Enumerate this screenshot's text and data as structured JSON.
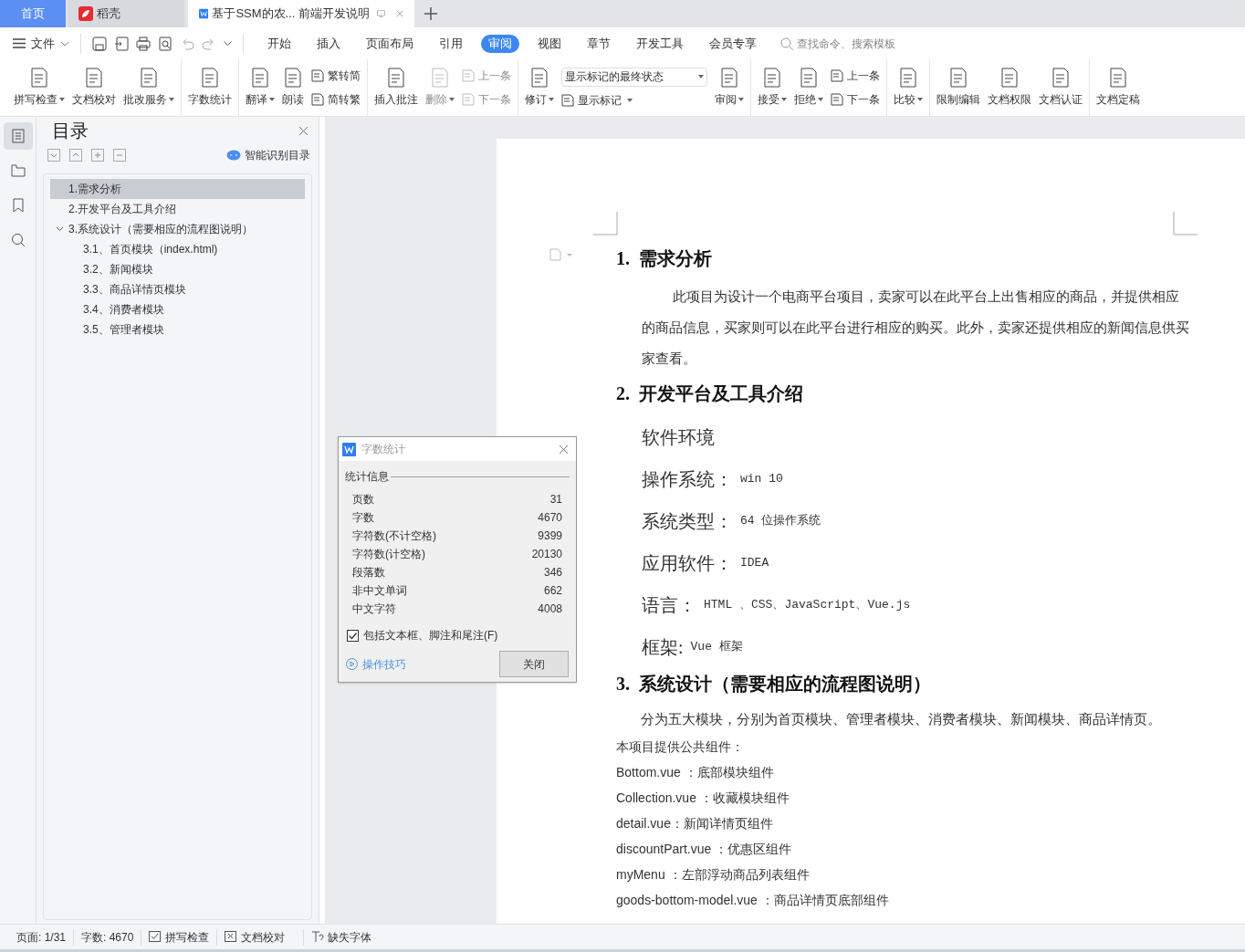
{
  "tabs": [
    {
      "kind": "home",
      "label": "首页",
      "selected": false
    },
    {
      "kind": "app",
      "label": "稻壳",
      "selected": false
    },
    {
      "kind": "document",
      "label": "基于SSM的农... 前端开发说明",
      "selected": true
    }
  ],
  "menu": {
    "file": "文件",
    "ribbon_tabs": [
      {
        "label": "开始",
        "selected": false
      },
      {
        "label": "插入",
        "selected": false
      },
      {
        "label": "页面布局",
        "selected": false
      },
      {
        "label": "引用",
        "selected": false
      },
      {
        "label": "审阅",
        "selected": true
      },
      {
        "label": "视图",
        "selected": false
      },
      {
        "label": "章节",
        "selected": false
      },
      {
        "label": "开发工具",
        "selected": false
      },
      {
        "label": "会员专享",
        "selected": false
      }
    ],
    "search": {
      "placeholder": "查找命令、搜索模板"
    }
  },
  "ribbon": [
    {
      "items": [
        {
          "kind": "large",
          "label": "拼写检查",
          "caret": true,
          "disabled": false
        },
        {
          "kind": "large",
          "label": "文档校对",
          "caret": false,
          "disabled": false
        },
        {
          "kind": "large",
          "label": "批改服务",
          "caret": true,
          "disabled": false
        }
      ]
    },
    {
      "items": [
        {
          "kind": "large",
          "label": "字数统计",
          "caret": false,
          "disabled": false
        }
      ]
    },
    {
      "items": [
        {
          "kind": "large",
          "label": "翻译",
          "caret": true,
          "disabled": false
        },
        {
          "kind": "large",
          "label": "朗读",
          "caret": false,
          "disabled": false
        },
        {
          "kind": "stack",
          "rows": [
            {
              "label": "繁转简",
              "disabled": false
            },
            {
              "label": "简转繁",
              "disabled": false
            }
          ]
        }
      ]
    },
    {
      "items": [
        {
          "kind": "large",
          "label": "插入批注",
          "caret": false,
          "disabled": false
        },
        {
          "kind": "large",
          "label": "删除",
          "caret": true,
          "disabled": true
        },
        {
          "kind": "stack",
          "rows": [
            {
              "label": "上一条",
              "disabled": true
            },
            {
              "label": "下一条",
              "disabled": true
            }
          ]
        }
      ]
    },
    {
      "items": [
        {
          "kind": "large",
          "label": "修订",
          "caret": true,
          "disabled": false
        },
        {
          "kind": "markup",
          "value": "显示标记的最终状态",
          "label": "显示标记"
        },
        {
          "kind": "large",
          "label": "审阅",
          "caret": true,
          "disabled": false
        }
      ]
    },
    {
      "items": [
        {
          "kind": "large",
          "label": "接受",
          "caret": true,
          "disabled": false
        },
        {
          "kind": "large",
          "label": "拒绝",
          "caret": true,
          "disabled": false
        },
        {
          "kind": "stack",
          "rows": [
            {
              "label": "上一条",
              "disabled": false
            },
            {
              "label": "下一条",
              "disabled": false
            }
          ]
        }
      ]
    },
    {
      "items": [
        {
          "kind": "large",
          "label": "比较",
          "caret": true,
          "disabled": false
        }
      ]
    },
    {
      "items": [
        {
          "kind": "large",
          "label": "限制编辑",
          "caret": false,
          "disabled": false
        },
        {
          "kind": "large",
          "label": "文档权限",
          "caret": false,
          "disabled": false
        },
        {
          "kind": "large",
          "label": "文档认证",
          "caret": false,
          "disabled": false
        }
      ]
    },
    {
      "items": [
        {
          "kind": "large",
          "label": "文档定稿",
          "caret": false,
          "disabled": false
        }
      ]
    }
  ],
  "side_tools": [
    {
      "selected": true
    },
    {
      "selected": false
    },
    {
      "selected": false
    },
    {
      "selected": false
    }
  ],
  "toc": {
    "title": "目录",
    "smart_button": "智能识别目录",
    "items": [
      {
        "label": "1.需求分析",
        "selected": true
      },
      {
        "label": "2.开发平台及工具介绍",
        "selected": false
      },
      {
        "label": "3.系统设计（需要相应的流程图说明）",
        "selected": false,
        "expanded": true,
        "children": [
          {
            "label": "3.1、首页模块（index.html)",
            "selected": false
          },
          {
            "label": "3.2、新闻模块",
            "selected": false
          },
          {
            "label": "3.3、商品详情页模块",
            "selected": false
          },
          {
            "label": "3.4、消费者模块",
            "selected": false
          },
          {
            "label": "3.5、管理者模块",
            "selected": false
          }
        ]
      }
    ]
  },
  "document": [
    {
      "kind": "heading",
      "number": "1.",
      "text": "需求分析"
    },
    {
      "kind": "para",
      "text": "此项目为设计一个电商平台项目，卖家可以在此平台上出售相应的商品，并提供相应的商品信息，买家则可以在此平台进行相应的购买。此外，卖家还提供相应的新闻信息供买家查看。"
    },
    {
      "kind": "heading",
      "number": "2.",
      "text": "开发平台及工具介绍"
    },
    {
      "kind": "label",
      "text": "软件环境"
    },
    {
      "kind": "field",
      "label": "操作系统：",
      "value": "win 10"
    },
    {
      "kind": "field",
      "label": "系统类型：",
      "value": "64 位操作系统"
    },
    {
      "kind": "field",
      "label": "应用软件：",
      "value": "IDEA"
    },
    {
      "kind": "field",
      "label": "语言：",
      "value": "HTML 、CSS、JavaScript、Vue.js"
    },
    {
      "kind": "field",
      "label": "框架:",
      "value": "Vue 框架"
    },
    {
      "kind": "heading",
      "number": "3.",
      "text": "系统设计（需要相应的流程图说明）"
    },
    {
      "kind": "plain",
      "text": "分为五大模块，分别为首页模块、管理者模块、消费者模块、新闻模块、商品详情页。"
    },
    {
      "kind": "line",
      "text": "本项目提供公共组件："
    },
    {
      "kind": "line",
      "text": "Bottom.vue ：底部模块组件"
    },
    {
      "kind": "line",
      "text": "Collection.vue ：收藏模块组件"
    },
    {
      "kind": "line",
      "text": "detail.vue：新闻详情页组件"
    },
    {
      "kind": "line",
      "text": "discountPart.vue ：优惠区组件"
    },
    {
      "kind": "line",
      "text": "myMenu ：左部浮动商品列表组件"
    },
    {
      "kind": "line",
      "text": "goods-bottom-model.vue ：商品详情页底部组件"
    }
  ],
  "dialog": {
    "title": "字数统计",
    "section": "统计信息",
    "rows": [
      {
        "label": "页数",
        "value": "31"
      },
      {
        "label": "字数",
        "value": "4670"
      },
      {
        "label": "字符数(不计空格)",
        "value": "9399"
      },
      {
        "label": "字符数(计空格)",
        "value": "20130"
      },
      {
        "label": "段落数",
        "value": "346"
      },
      {
        "label": "非中文单词",
        "value": "662"
      },
      {
        "label": "中文字符",
        "value": "4008"
      }
    ],
    "checkbox": {
      "label": "包括文本框、脚注和尾注(F)",
      "checked": true
    },
    "tips": "操作技巧",
    "close": "关闭"
  },
  "status_bar": [
    {
      "kind": "text",
      "label": "页面: 1/31"
    },
    {
      "kind": "text",
      "label": "字数: 4670"
    },
    {
      "kind": "check",
      "label": "拼写检查"
    },
    {
      "kind": "proof",
      "label": "文档校对"
    },
    {
      "kind": "font",
      "label": "缺失字体"
    }
  ]
}
